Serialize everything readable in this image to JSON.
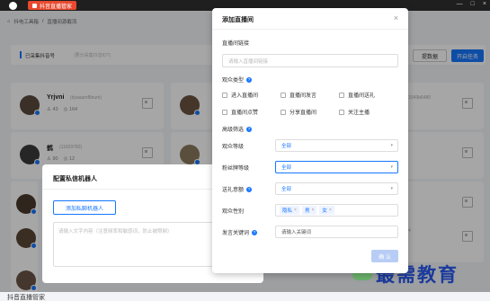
{
  "titlebar": {
    "brand": "抖音直播管家"
  },
  "breadcrumb": {
    "item1": "抖电工具箱",
    "sep": "/",
    "item2": "直播间源截流"
  },
  "toolbar": {
    "collected_label": "已采集抖音号",
    "collected_placeholder": "(要分采集抖音ID?)",
    "data_button": "提数据",
    "start_button": "开启任务"
  },
  "cards": [
    {
      "name": "Yrjvni",
      "id": "(dyaaamf8num)",
      "likes": "43",
      "fans": "164"
    },
    {
      "name": "鹤",
      "id": "(11603782)",
      "likes": "90",
      "fans": "12"
    }
  ],
  "right_ids": [
    "3349b6480",
    "4"
  ],
  "robot_dialog": {
    "title": "配置私信机器人",
    "add_button": "添加私聊机器人",
    "placeholder": "请输入文字内容（注意频率和敏感词，防止被限制）"
  },
  "dialog": {
    "title": "添加直播间",
    "close": "×",
    "link_label": "直播间链接",
    "link_placeholder": "请输入直播间链接",
    "type_label": "观众类型",
    "checkboxes": [
      "进入直播间",
      "直播间发言",
      "直播间送礼",
      "直播间点赞",
      "分享直播间",
      "关注主播"
    ],
    "filter_label": "高级筛选",
    "fields": {
      "level_label": "观众等级",
      "level_value": "全部",
      "fan_label": "粉丝牌等级",
      "fan_value": "全部",
      "gift_label": "送礼意额",
      "gift_value": "全部",
      "gender_label": "观众性别",
      "gender_tags": [
        "隐私",
        "男",
        "女"
      ],
      "keyword_label": "发言关键词",
      "keyword_placeholder": "请输入关键词"
    },
    "confirm": "确 认"
  },
  "footer": {
    "title": "抖音直播管家"
  },
  "watermark": "最需教育",
  "colors": {
    "primary": "#1677ff",
    "brand": "#e8492f"
  }
}
